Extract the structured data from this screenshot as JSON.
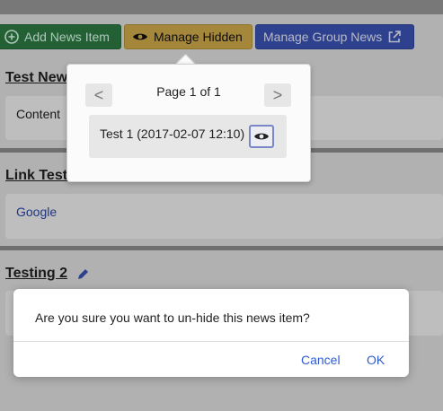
{
  "toolbar": {
    "add_label": "Add News Item",
    "hidden_label": "Manage Hidden",
    "group_label": "Manage Group News"
  },
  "news": [
    {
      "title": "Test New",
      "content": "Content"
    },
    {
      "title": "Link Test",
      "content": "Google"
    },
    {
      "title": "Testing 2",
      "content": ""
    }
  ],
  "popover": {
    "page_label": "Page 1 of 1",
    "prev_label": "<",
    "next_label": ">",
    "hidden_items": [
      {
        "label": "Test 1 (2017-02-07 12:10)"
      }
    ]
  },
  "modal": {
    "message": "Are you sure you want to un-hide this news item?",
    "cancel_label": "Cancel",
    "ok_label": "OK"
  },
  "icons": {
    "add": "plus-circle-icon",
    "eye": "eye-icon",
    "external": "external-link-icon",
    "edit": "pencil-icon"
  }
}
